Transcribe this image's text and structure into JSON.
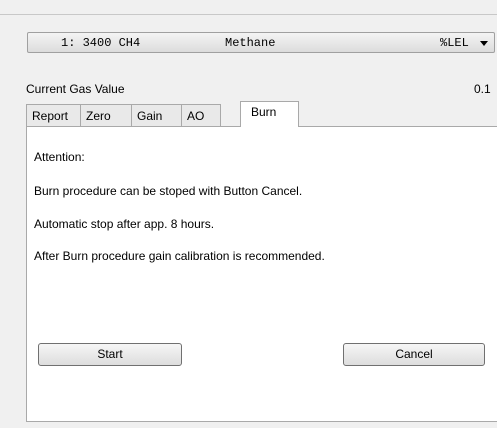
{
  "gas_selector": {
    "channel": "1: 3400 CH4",
    "name": "Methane",
    "unit": "%LEL"
  },
  "current_gas": {
    "label": "Current Gas Value",
    "value": "0.1"
  },
  "tabs": [
    {
      "label": "Report",
      "active": false
    },
    {
      "label": "Zero",
      "active": false
    },
    {
      "label": "Gain",
      "active": false
    },
    {
      "label": "AO",
      "active": false
    },
    {
      "label": "Burn",
      "active": true
    }
  ],
  "burn_panel": {
    "attention": "Attention:",
    "line1": "Burn procedure can be stoped with Button Cancel.",
    "line2": "Automatic stop after app. 8 hours.",
    "line3": "After Burn procedure gain calibration is recommended.",
    "start_label": "Start",
    "cancel_label": "Cancel"
  }
}
